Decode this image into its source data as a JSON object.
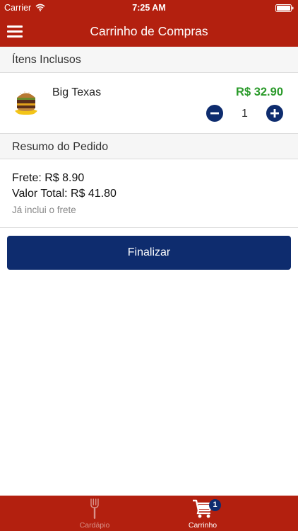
{
  "status_bar": {
    "carrier": "Carrier",
    "time": "7:25 AM"
  },
  "nav": {
    "title": "Carrinho de Compras",
    "menu_icon": "hamburger-menu-icon"
  },
  "items_section": {
    "header": "Ítens Inclusos",
    "items": [
      {
        "name": "Big Texas",
        "price": "R$ 32.90",
        "quantity": "1",
        "thumbnail_icon": "burger-thumbnail"
      }
    ]
  },
  "summary_section": {
    "header": "Resumo do Pedido",
    "frete": "Frete: R$ 8.90",
    "total": "Valor Total: R$ 41.80",
    "note": "Já inclui o frete"
  },
  "actions": {
    "finalize_label": "Finalizar"
  },
  "tab_bar": {
    "tabs": [
      {
        "label": "Cardápio",
        "icon": "fork-icon",
        "active": false
      },
      {
        "label": "Carrinho",
        "icon": "cart-icon",
        "active": true,
        "badge": "1"
      }
    ]
  },
  "colors": {
    "brand_red": "#b3200f",
    "brand_navy": "#0e2c6e",
    "price_green": "#2a9a2a"
  }
}
